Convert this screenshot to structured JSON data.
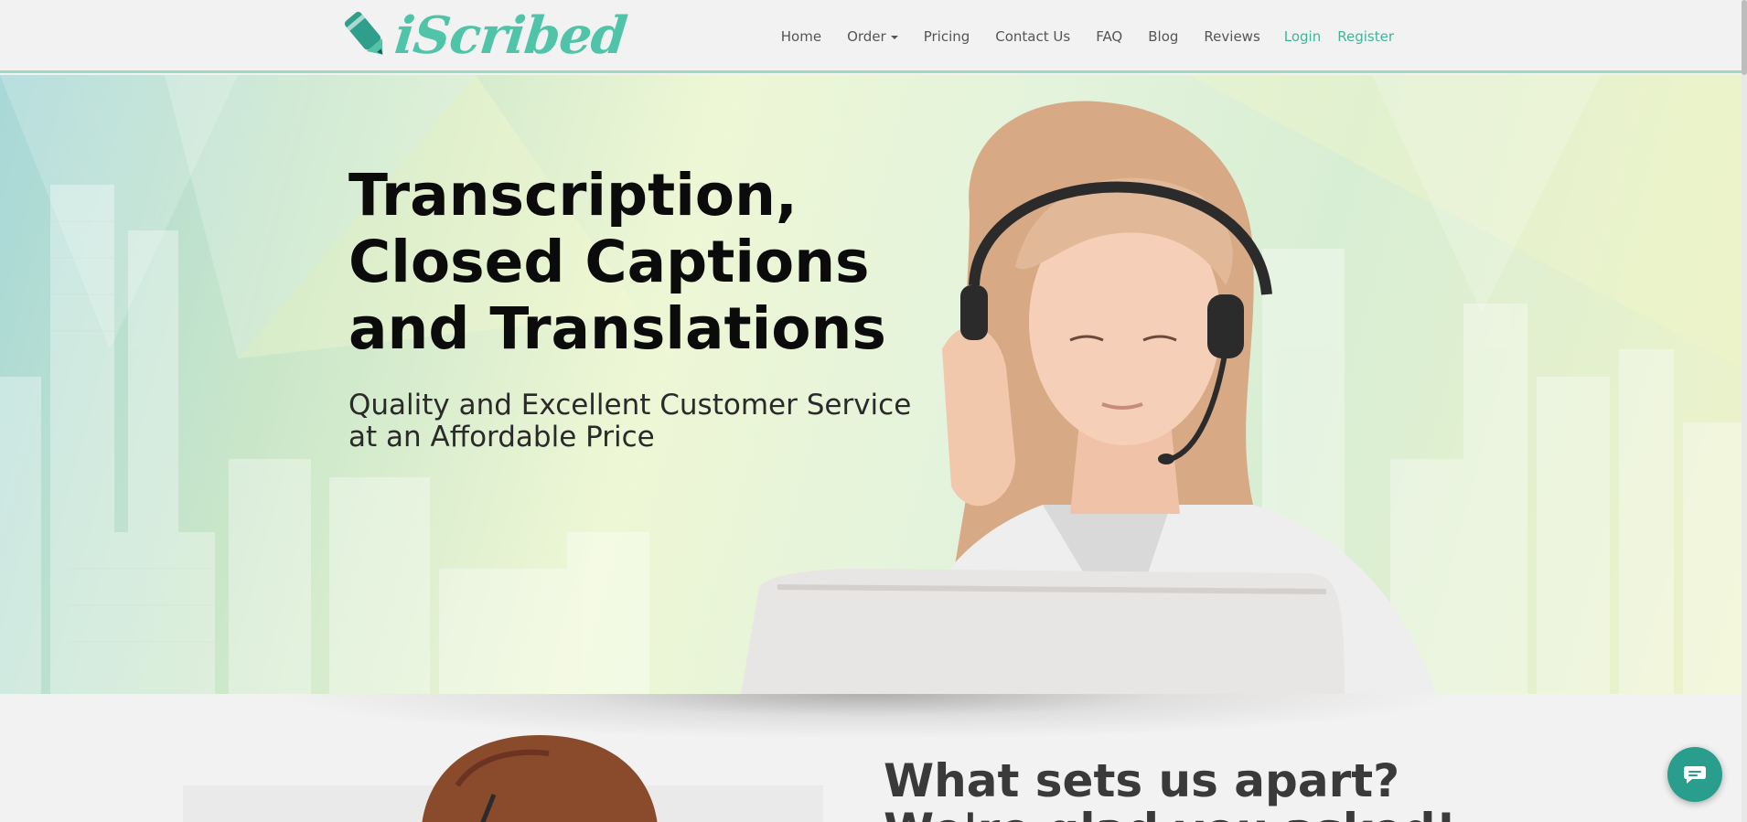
{
  "brand": {
    "name": "iScribed",
    "color": "#4fc4a8"
  },
  "nav": {
    "items": [
      {
        "label": "Home"
      },
      {
        "label": "Order",
        "has_dropdown": true
      },
      {
        "label": "Pricing"
      },
      {
        "label": "Contact Us"
      },
      {
        "label": "FAQ"
      },
      {
        "label": "Blog"
      },
      {
        "label": "Reviews"
      }
    ],
    "login": "Login",
    "register": "Register",
    "accent_color": "#3fb69a"
  },
  "hero": {
    "title_lines": [
      "Transcription,",
      "Closed Captions",
      "and Translations"
    ],
    "subtitle_lines": [
      "Quality and Excellent Customer Service",
      "at an Affordable Price"
    ]
  },
  "section2": {
    "heading_lines": [
      "What sets us apart?",
      "We're glad you asked!"
    ]
  },
  "chat": {
    "icon": "chat-bubble-icon",
    "color": "#2a9e8c"
  }
}
